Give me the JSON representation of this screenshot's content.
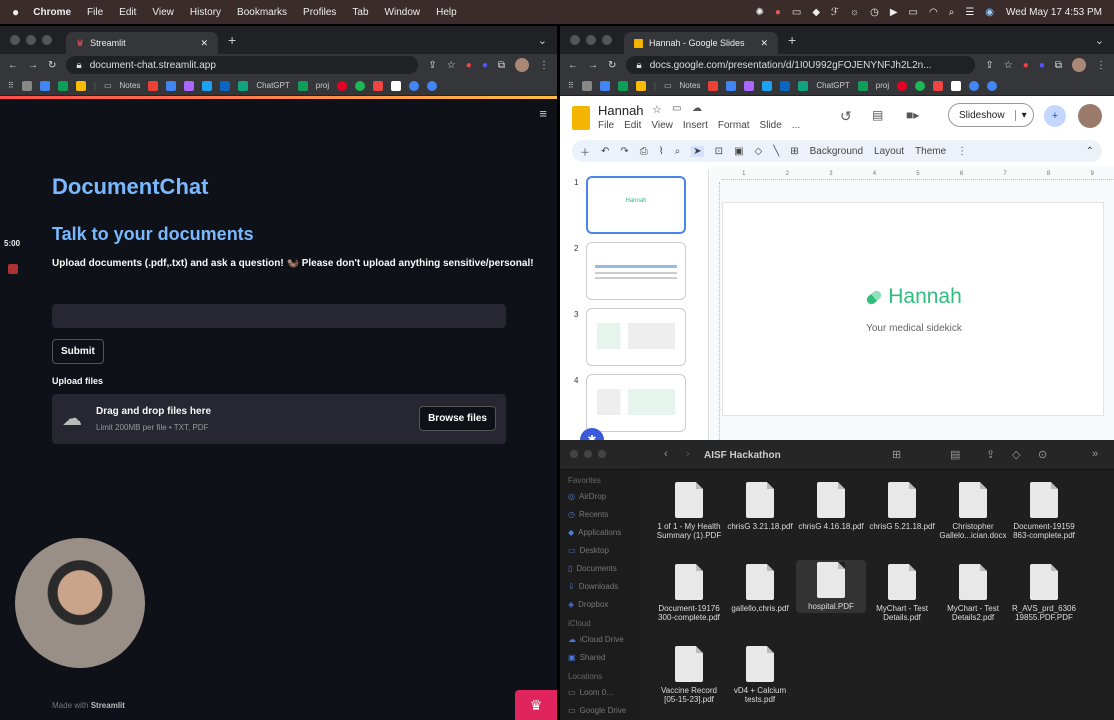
{
  "menubar": {
    "apple": "",
    "app": "Chrome",
    "items": [
      "File",
      "Edit",
      "View",
      "History",
      "Bookmarks",
      "Profiles",
      "Tab",
      "Window",
      "Help"
    ],
    "clock": "Wed May 17  4:53 PM"
  },
  "left_browser": {
    "tab_title": "Streamlit",
    "url": "document-chat.streamlit.app",
    "bookmarks": [
      "Notes",
      "ChatGPT",
      "proj"
    ]
  },
  "streamlit": {
    "title": "DocumentChat",
    "subtitle": "Talk to your documents",
    "description": "Upload documents (.pdf,.txt) and ask a question! 🦦 Please don't upload anything sensitive/personal!",
    "input_value": "",
    "submit_label": "Submit",
    "upload_label": "Upload files",
    "drop_title": "Drag and drop files here",
    "drop_hint": "Limit 200MB per file • TXT, PDF",
    "browse_label": "Browse files",
    "footer_prefix": "Made with ",
    "footer_brand": "Streamlit",
    "timer": "5:00"
  },
  "right_browser": {
    "tab_title": "Hannah - Google Slides",
    "url": "docs.google.com/presentation/d/1I0U992gFOJENYNFJh2L2n...",
    "bookmarks": [
      "Notes",
      "ChatGPT",
      "proj"
    ]
  },
  "slides": {
    "doc_title": "Hannah",
    "menu": [
      "File",
      "Edit",
      "View",
      "Insert",
      "Format",
      "Slide",
      "..."
    ],
    "slideshow_label": "Slideshow",
    "toolbar": [
      "Background",
      "Layout",
      "Theme"
    ],
    "slide_numbers": [
      "1",
      "2",
      "3",
      "4"
    ],
    "slide_title": "Hannah",
    "slide_subtitle": "Your medical sidekick",
    "ruler_ticks": [
      "1",
      "2",
      "3",
      "4",
      "5",
      "6",
      "7",
      "8",
      "9"
    ]
  },
  "finder": {
    "folder": "AISF Hackathon",
    "sidebar": {
      "favorites_label": "Favorites",
      "favorites": [
        "AirDrop",
        "Recents",
        "Applications",
        "Desktop",
        "Documents",
        "Downloads",
        "Dropbox"
      ],
      "icloud_label": "iCloud",
      "icloud": [
        "iCloud Drive",
        "Shared"
      ],
      "locations_label": "Locations",
      "locations": [
        "Loom 0...",
        "Google Drive"
      ]
    },
    "files": [
      "1 of 1 - My Health Summary (1).PDF",
      "chrisG 3.21.18.pdf",
      "chrisG 4.16.18.pdf",
      "chrisG 5.21.18.pdf",
      "Christopher Gallelo...ician.docx",
      "Document-19159 863-complete.pdf",
      "Document-19176 300-complete.pdf",
      "gallello,chris.pdf",
      "hospital.PDF",
      "MyChart - Test Details.pdf",
      "MyChart - Test Details2.pdf",
      "R_AVS_prd_6306 19855.PDF.PDF",
      "Vaccine Record [05-15-23].pdf",
      "vD4 + Calcium tests.pdf"
    ]
  },
  "colors": {
    "streamlit_accent": "#7ab8ff",
    "hannah_green": "#2ebf7e",
    "record_red": "#e0245e"
  }
}
